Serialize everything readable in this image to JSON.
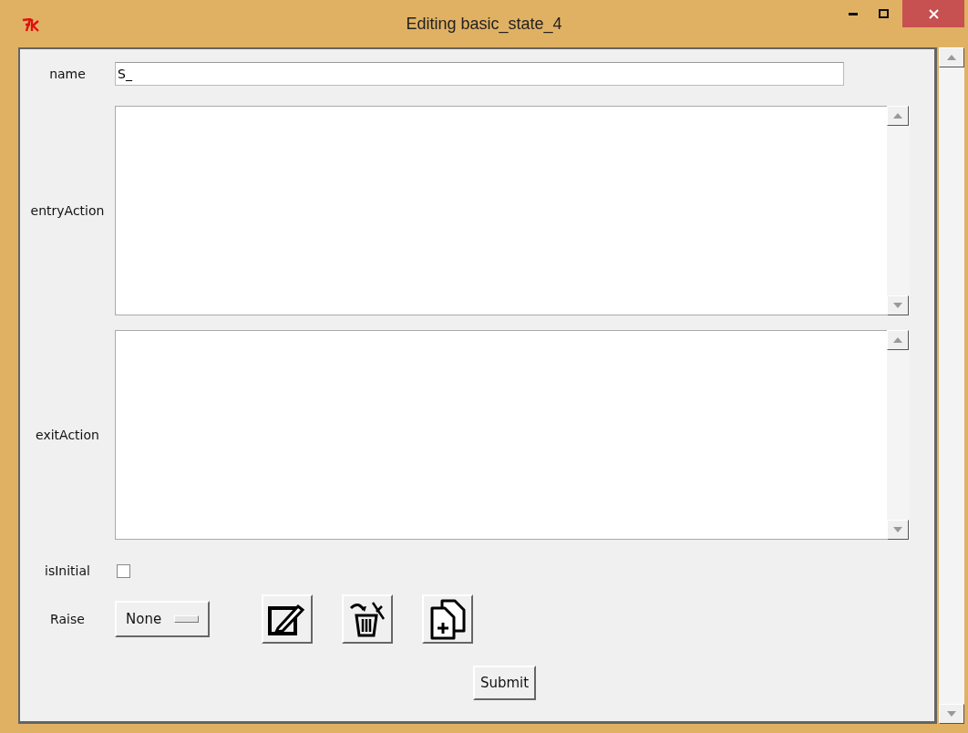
{
  "window": {
    "title": "Editing basic_state_4"
  },
  "form": {
    "name": {
      "label": "name",
      "value": "S_"
    },
    "text_areas": [
      {
        "label": "entryAction"
      },
      {
        "label": "exitAction"
      }
    ],
    "is_initial": {
      "label": "isInitial",
      "checked": false
    },
    "raise": {
      "label": "Raise",
      "value": "None"
    },
    "submit": "Submit"
  }
}
